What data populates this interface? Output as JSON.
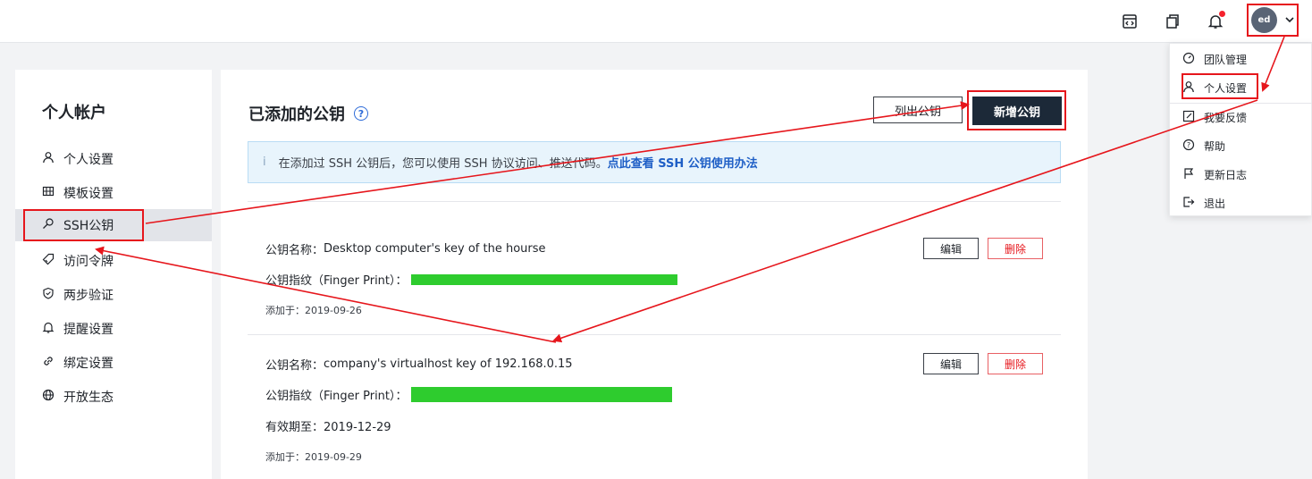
{
  "header": {
    "icons": [
      "code-icon",
      "copy-window-icon",
      "bell-icon"
    ],
    "avatar_initials": "ed"
  },
  "dropdown": {
    "items": [
      {
        "label": "团队管理",
        "icon": "dashboard-icon"
      },
      {
        "label": "个人设置",
        "icon": "user-icon"
      },
      {
        "label": "我要反馈",
        "icon": "edit-icon"
      },
      {
        "label": "帮助",
        "icon": "help-icon"
      },
      {
        "label": "更新日志",
        "icon": "flag-icon"
      },
      {
        "label": "退出",
        "icon": "logout-icon"
      }
    ]
  },
  "sidebar": {
    "title": "个人帐户",
    "items": [
      {
        "label": "个人设置",
        "icon": "user-icon"
      },
      {
        "label": "模板设置",
        "icon": "grid-icon"
      },
      {
        "label": "SSH公钥",
        "icon": "key-icon",
        "active": true
      },
      {
        "label": "访问令牌",
        "icon": "tag-icon"
      },
      {
        "label": "两步验证",
        "icon": "shield-icon"
      },
      {
        "label": "提醒设置",
        "icon": "bell-icon"
      },
      {
        "label": "绑定设置",
        "icon": "link-icon"
      },
      {
        "label": "开放生态",
        "icon": "globe-icon"
      }
    ]
  },
  "main": {
    "title": "已添加的公钥",
    "help_glyph": "?",
    "list_button": "列出公钥",
    "add_button": "新增公钥",
    "info_glyph": "i",
    "info_text": "在添加过 SSH 公钥后，您可以使用 SSH 协议访问、推送代码。",
    "info_link": "点此查看 SSH 公钥使用办法",
    "keys": [
      {
        "name_label": "公钥名称：",
        "name": "Desktop computer's key of the hourse",
        "fp_label": "公钥指纹（Finger Print）：",
        "added": "添加于：2019-09-26",
        "edit": "编辑",
        "delete": "删除"
      },
      {
        "name_label": "公钥名称：",
        "name": "company's virtualhost key of 192.168.0.15",
        "fp_label": "公钥指纹（Finger Print）：",
        "expiry": "有效期至：2019-12-29",
        "added": "添加于：2019-09-29",
        "edit": "编辑",
        "delete": "删除"
      }
    ]
  },
  "colors": {
    "annotation_red": "#e6161c",
    "primary_dark": "#1c2938",
    "fingerprint_green": "#2ecc2e",
    "link_blue": "#1f5fc6"
  }
}
